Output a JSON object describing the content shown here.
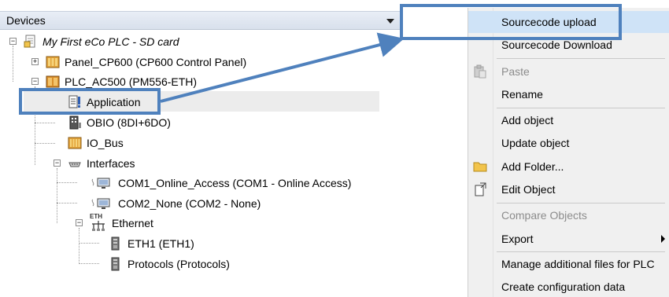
{
  "devices_panel": {
    "title": "Devices",
    "tree": [
      {
        "label": "My First eCo PLC - SD card",
        "icon": "project-icon"
      },
      {
        "label": "Panel_CP600 (CP600 Control Panel)",
        "icon": "panel-device-icon"
      },
      {
        "label": "PLC_AC500 (PM556-ETH)",
        "icon": "plc-device-icon"
      },
      {
        "label": "Application",
        "icon": "application-icon"
      },
      {
        "label": "OBIO (8DI+6DO)",
        "icon": "io-module-icon"
      },
      {
        "label": "IO_Bus",
        "icon": "io-bus-icon"
      },
      {
        "label": "Interfaces",
        "icon": "interfaces-icon"
      },
      {
        "label": "COM1_Online_Access (COM1 - Online Access)",
        "icon": "com-port-icon"
      },
      {
        "label": "COM2_None (COM2 - None)",
        "icon": "com-port-icon"
      },
      {
        "label": "Ethernet",
        "icon": "ethernet-icon"
      },
      {
        "label": "ETH1 (ETH1)",
        "icon": "eth-port-icon"
      },
      {
        "label": "Protocols (Protocols)",
        "icon": "eth-port-icon"
      }
    ],
    "ethernet_icon_text": "ETH"
  },
  "context_menu": {
    "items": [
      {
        "label": "Sourcecode upload",
        "enabled": true,
        "highlighted": true
      },
      {
        "label": "Sourcecode Download",
        "enabled": true
      },
      {
        "label": "Paste",
        "enabled": false,
        "icon": "paste-icon"
      },
      {
        "label": "Rename",
        "enabled": true
      },
      {
        "label": "Add object",
        "enabled": true
      },
      {
        "label": "Update object",
        "enabled": true
      },
      {
        "label": "Add Folder...",
        "enabled": true,
        "icon": "folder-icon"
      },
      {
        "label": "Edit Object",
        "enabled": true,
        "icon": "edit-object-icon"
      },
      {
        "label": "Compare Objects",
        "enabled": false
      },
      {
        "label": "Export",
        "enabled": true,
        "submenu": true
      },
      {
        "label": "Manage additional files for PLC",
        "enabled": true
      },
      {
        "label": "Create configuration data",
        "enabled": true
      }
    ]
  },
  "colors": {
    "annotation": "#4f81bd",
    "menu_highlight": "#cfe3f7",
    "menu_disabled_text": "#8c8c8c"
  }
}
